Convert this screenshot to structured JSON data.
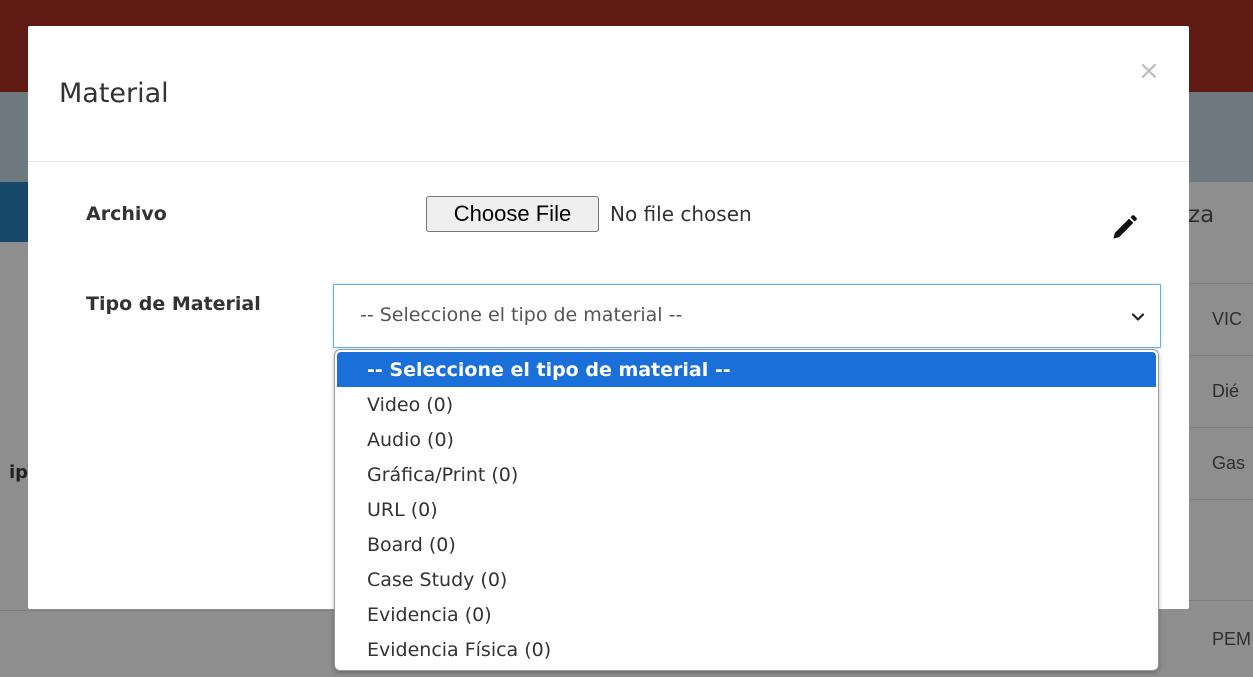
{
  "background": {
    "header_partial": "za",
    "left_partial": "ip",
    "rows": [
      "VIC",
      "Dié",
      "Gas",
      "PEM"
    ]
  },
  "modal": {
    "title": "Material",
    "close_symbol": "×"
  },
  "form": {
    "archivo_label": "Archivo",
    "file_button_label": "Choose File",
    "file_status": "No file chosen",
    "tipo_label": "Tipo de Material",
    "tipo_selected": "-- Seleccione el tipo de material --"
  },
  "dropdown": {
    "options": [
      "-- Seleccione el tipo de material --",
      "Video (0)",
      "Audio (0)",
      "Gráfica/Print (0)",
      "URL (0)",
      "Board (0)",
      "Case Study (0)",
      "Evidencia (0)",
      "Evidencia Física (0)"
    ],
    "selected_index": 0
  },
  "colors": {
    "topbar": "#5e1a13",
    "accent_blue": "#1a6fd8",
    "focus_border": "#66afe9"
  },
  "icons": {
    "edit": "pencil-icon",
    "dropdown": "chevron-down-icon",
    "close": "close-icon"
  }
}
